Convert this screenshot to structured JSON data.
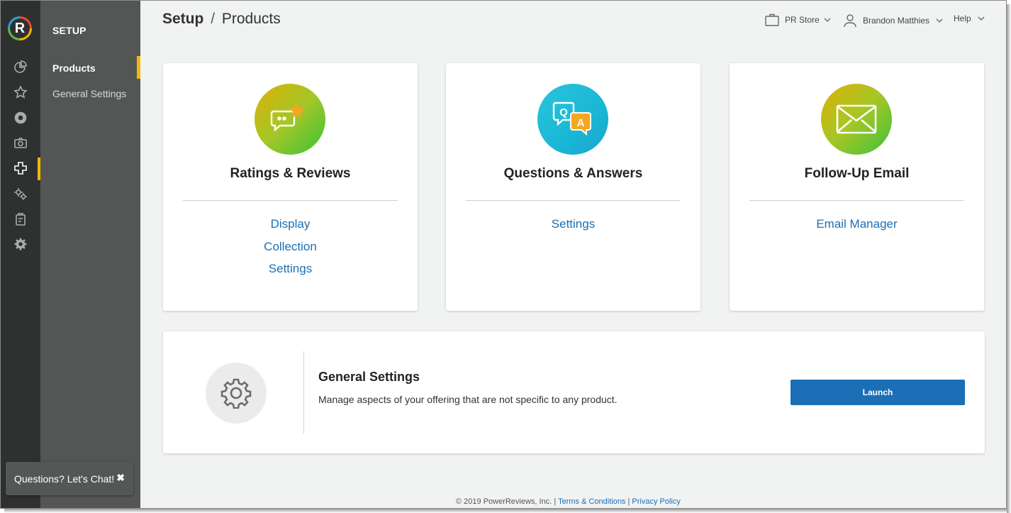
{
  "app": {
    "logo_letter": "R"
  },
  "rail": {
    "icons": [
      "pie-chart-icon",
      "star-icon",
      "disc-icon",
      "camera-icon",
      "plus-icon",
      "gears-icon",
      "clipboard-icon",
      "gear-icon"
    ],
    "active": "plus-icon",
    "accent": "#f5b800"
  },
  "subnav": {
    "title": "SETUP",
    "items": [
      {
        "label": "Products",
        "active": true
      },
      {
        "label": "General Settings",
        "active": false
      }
    ]
  },
  "header": {
    "breadcrumb_root": "Setup",
    "breadcrumb_sep": "/",
    "breadcrumb_page": "Products",
    "store": "PR Store",
    "user": "Brandon Matthies",
    "help": "Help"
  },
  "cards": [
    {
      "title": "Ratings & Reviews",
      "icon": "reviews-chat-star-icon",
      "links": [
        "Display",
        "Collection",
        "Settings"
      ]
    },
    {
      "title": "Questions & Answers",
      "icon": "qa-bubbles-icon",
      "links": [
        "Settings"
      ]
    },
    {
      "title": "Follow-Up Email",
      "icon": "envelope-icon",
      "links": [
        "Email Manager"
      ]
    }
  ],
  "general_settings": {
    "title": "General Settings",
    "description": "Manage aspects of your offering that are not specific to any product.",
    "button": "Launch"
  },
  "footer": {
    "copyright": "© 2019 PowerReviews, Inc. |",
    "terms": "Terms & Conditions",
    "sep": "|",
    "privacy": "Privacy Policy"
  },
  "chat": {
    "label": "Questions? Let's Chat!",
    "close": "✖"
  },
  "colors": {
    "link": "#1a6fb6",
    "button": "#1a6fb6",
    "rail": "#2f3131",
    "subnav": "#545656"
  }
}
